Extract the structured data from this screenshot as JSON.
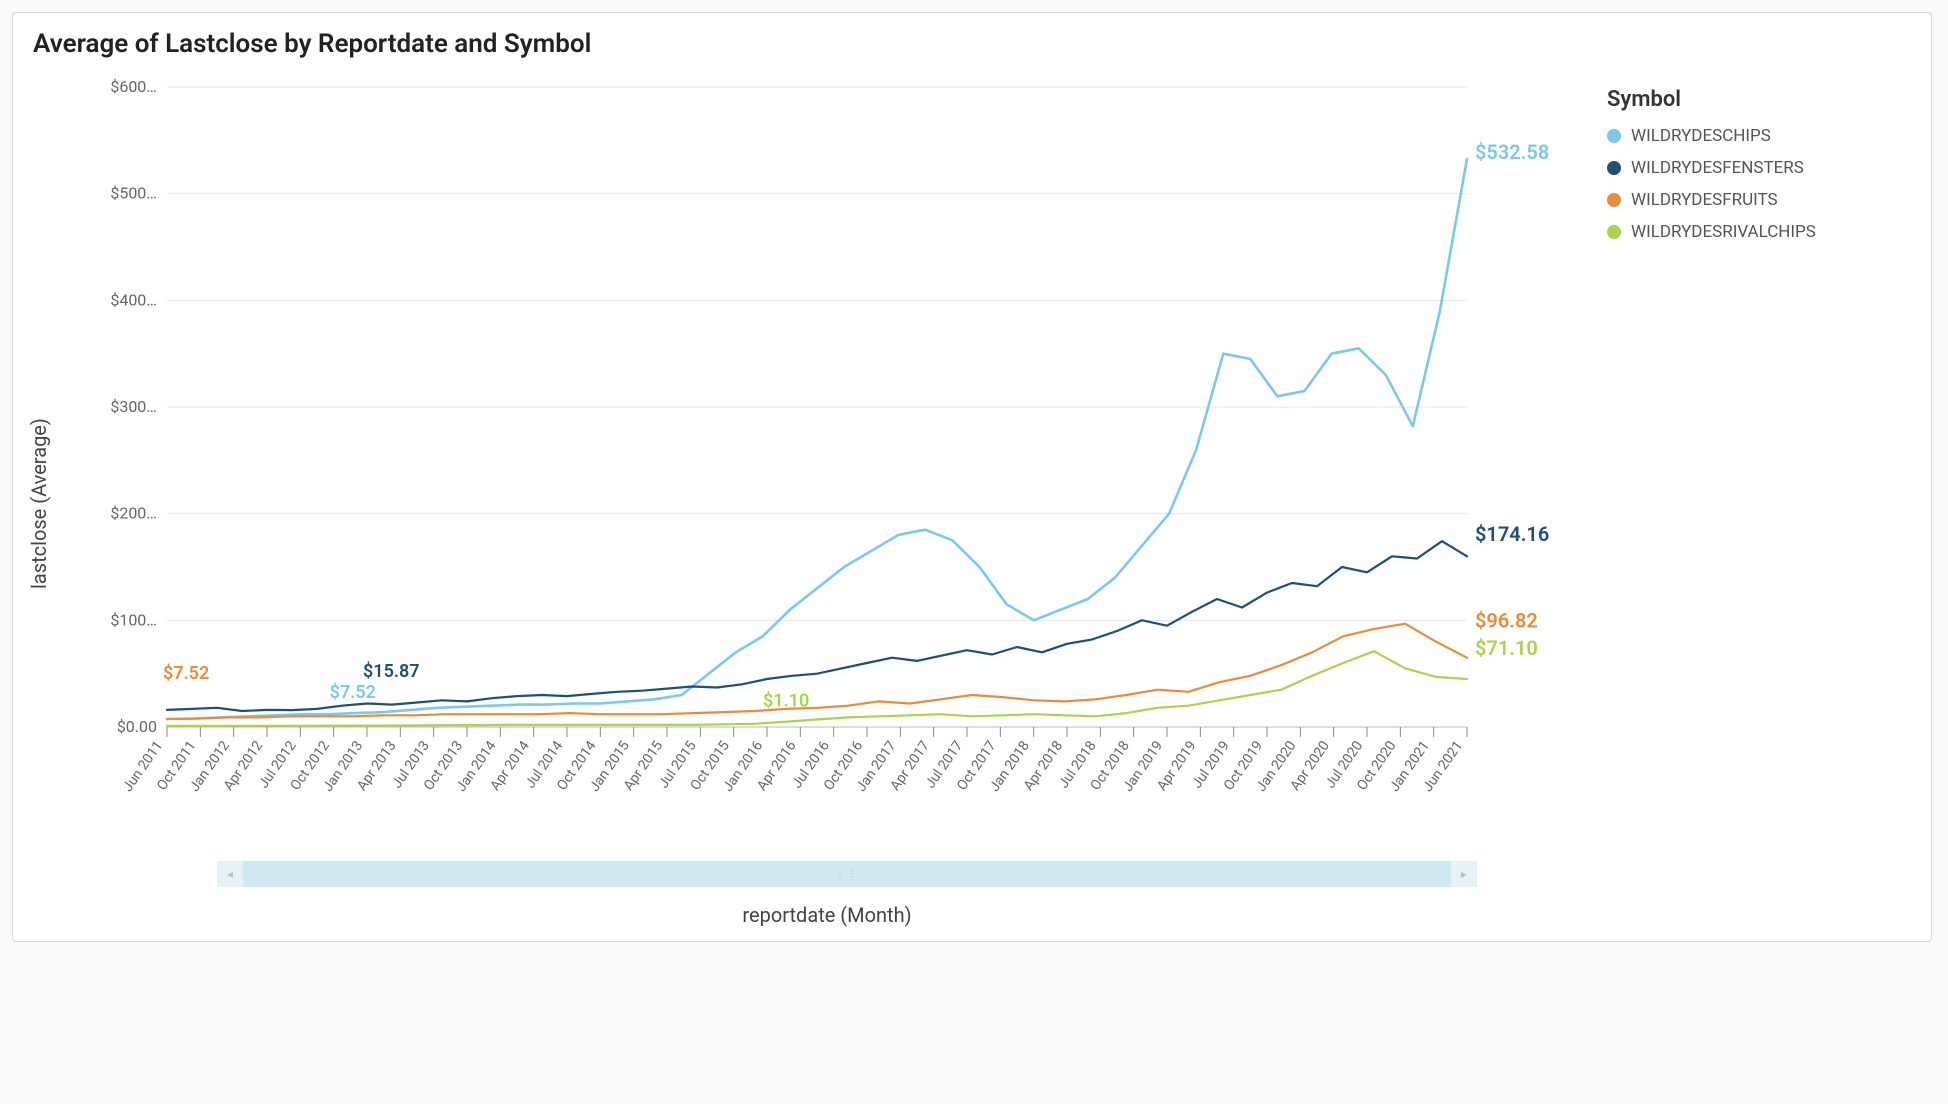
{
  "title": "Average of Lastclose by Reportdate and Symbol",
  "ylabel": "lastclose (Average)",
  "xlabel": "reportdate (Month)",
  "legend_title": "Symbol",
  "chart_data": {
    "type": "line",
    "ylim": [
      0,
      600
    ],
    "yticks": [
      "$0.00",
      "$100…",
      "$200…",
      "$300…",
      "$400…",
      "$500…",
      "$600…"
    ],
    "categories": [
      "Jun 2011",
      "Oct 2011",
      "Jan 2012",
      "Apr 2012",
      "Jul 2012",
      "Oct 2012",
      "Jan 2013",
      "Apr 2013",
      "Jul 2013",
      "Oct 2013",
      "Jan 2014",
      "Apr 2014",
      "Jul 2014",
      "Oct 2014",
      "Jan 2015",
      "Apr 2015",
      "Jul 2015",
      "Oct 2015",
      "Jan 2016",
      "Apr 2016",
      "Jul 2016",
      "Oct 2016",
      "Jan 2017",
      "Apr 2017",
      "Jul 2017",
      "Oct 2017",
      "Jan 2018",
      "Apr 2018",
      "Jul 2018",
      "Oct 2018",
      "Jan 2019",
      "Apr 2019",
      "Jul 2019",
      "Oct 2019",
      "Jan 2020",
      "Apr 2020",
      "Jul 2020",
      "Oct 2020",
      "Jan 2021",
      "Jun 2021"
    ],
    "series": [
      {
        "name": "WILDRYDESCHIPS",
        "color": "#7cc8e8",
        "end_label": "$532.58",
        "start_label": "$7.52",
        "values": [
          7.52,
          8,
          9,
          10,
          11,
          12,
          12,
          13,
          14,
          16,
          18,
          19,
          20,
          21,
          21,
          22,
          22,
          24,
          26,
          30,
          50,
          70,
          85,
          110,
          130,
          150,
          165,
          180,
          185,
          175,
          150,
          115,
          100,
          110,
          120,
          140,
          170,
          200,
          260,
          350,
          345,
          310,
          315,
          350,
          355,
          330,
          282,
          390,
          532.58
        ]
      },
      {
        "name": "WILDRYDESFENSTERS",
        "color": "#1f4e79",
        "end_label": "$174.16",
        "mid_label": "$15.87",
        "values": [
          16,
          17,
          18,
          15,
          16,
          15.87,
          17,
          20,
          22,
          21,
          23,
          25,
          24,
          27,
          29,
          30,
          29,
          31,
          33,
          34,
          36,
          38,
          37,
          40,
          45,
          48,
          50,
          55,
          60,
          65,
          62,
          67,
          72,
          68,
          75,
          70,
          78,
          82,
          90,
          100,
          95,
          108,
          120,
          112,
          126,
          135,
          132,
          150,
          145,
          160,
          158,
          174.16,
          160
        ]
      },
      {
        "name": "WILDRYDESFRUITS",
        "color": "#e98b3a",
        "end_label": "$96.82",
        "start_label": "$7.52",
        "values": [
          7.52,
          8,
          9,
          9,
          10,
          10,
          10,
          11,
          11,
          12,
          12,
          12,
          12,
          13,
          12,
          12,
          12,
          13,
          14,
          15,
          17,
          18,
          20,
          24,
          22,
          26,
          30,
          28,
          25,
          24,
          26,
          30,
          35,
          33,
          42,
          48,
          58,
          70,
          85,
          92,
          96.82,
          80,
          65
        ]
      },
      {
        "name": "WILDRYDESRIVALCHIPS",
        "color": "#a8d34b",
        "end_label": "$71.10",
        "mid_label": "$1.10",
        "values": [
          1.1,
          1.1,
          1.1,
          1.1,
          1.1,
          1.2,
          1.3,
          1.3,
          1.5,
          1.7,
          1.8,
          2,
          2,
          2,
          2,
          2,
          2,
          2,
          2.5,
          3,
          5,
          7,
          9,
          10,
          11,
          12,
          10,
          11,
          12,
          11,
          10,
          13,
          18,
          20,
          25,
          30,
          35,
          48,
          60,
          71.1,
          55,
          47,
          45
        ]
      }
    ]
  },
  "annotations": [
    {
      "text": "$7.52",
      "color": "#e98b3a",
      "x_index": 0,
      "y": 30,
      "dy": -16
    },
    {
      "text": "$7.52",
      "color": "#7cc8e8",
      "x_index": 5,
      "y": 12,
      "dy": -16
    },
    {
      "text": "$15.87",
      "color": "#1f4e79",
      "x_index": 6,
      "y": 30,
      "dy": -18
    },
    {
      "text": "$1.10",
      "color": "#a8d34b",
      "x_index": 18,
      "y": 6,
      "dy": -14
    },
    {
      "text": "$532.58",
      "color": "#7cc8e8",
      "end": true,
      "y": 532.58,
      "dy": 0
    },
    {
      "text": "$174.16",
      "color": "#1f4e79",
      "end": true,
      "y": 174.16,
      "dy": 0
    },
    {
      "text": "$96.82",
      "color": "#e98b3a",
      "end": true,
      "y": 96.82,
      "dy": 4
    },
    {
      "text": "$71.10",
      "color": "#a8d34b",
      "end": true,
      "y": 71.1,
      "dy": 4
    }
  ]
}
